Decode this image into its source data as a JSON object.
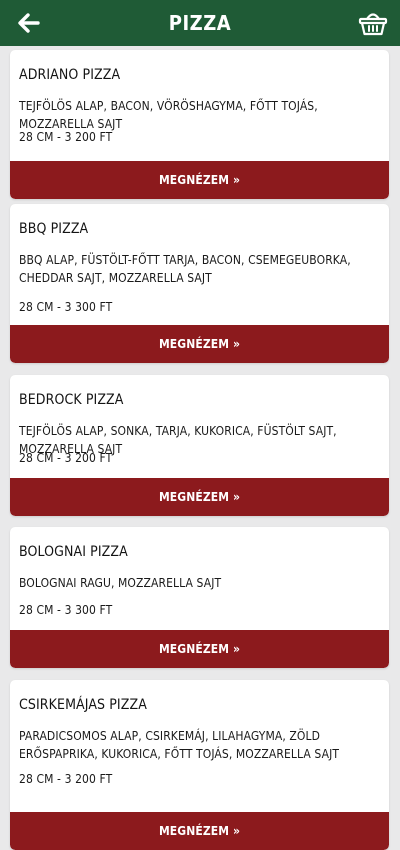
{
  "header": {
    "title": "PIZZA",
    "back_icon": "arrow-left-icon",
    "cart_icon": "basket-icon",
    "color": "#1f5b36"
  },
  "accent_color": "#8c1a1d",
  "items": [
    {
      "name": "ADRIANO PIZZA",
      "description": "TEJFÖLÖS ALAP, BACON, VÖRÖSHAGYMA, FŐTT TOJÁS, MOZZARELLA SAJT",
      "price": "28 CM - 3 200 FT",
      "button": "MEGNÉZEM »"
    },
    {
      "name": "BBQ PIZZA",
      "description": "BBQ ALAP, FÜSTÖLT-FŐTT TARJA, BACON, CSEMEGEUBORKA, CHEDDAR SAJT, MOZZARELLA SAJT",
      "price": "28 CM - 3 300 FT",
      "button": "MEGNÉZEM »"
    },
    {
      "name": "BEDROCK PIZZA",
      "description": "TEJFÖLÖS ALAP, SONKA, TARJA, KUKORICA, FÜSTÖLT SAJT, MOZZARELLA SAJT",
      "price": "28 CM - 3 200 FT",
      "button": "MEGNÉZEM »"
    },
    {
      "name": "BOLOGNAI PIZZA",
      "description": "BOLOGNAI RAGU, MOZZARELLA SAJT",
      "price": "28 CM - 3 300 FT",
      "button": "MEGNÉZEM »"
    },
    {
      "name": "CSIRKEMÁJAS PIZZA",
      "description": "PARADICSOMOS ALAP, CSIRKEMÁJ, LILAHAGYMA, ZÖLD ERŐSPAPRIKA, KUKORICA, FŐTT TOJÁS, MOZZARELLA SAJT",
      "price": "28 CM - 3 200 FT",
      "button": "MEGNÉZEM »"
    }
  ]
}
